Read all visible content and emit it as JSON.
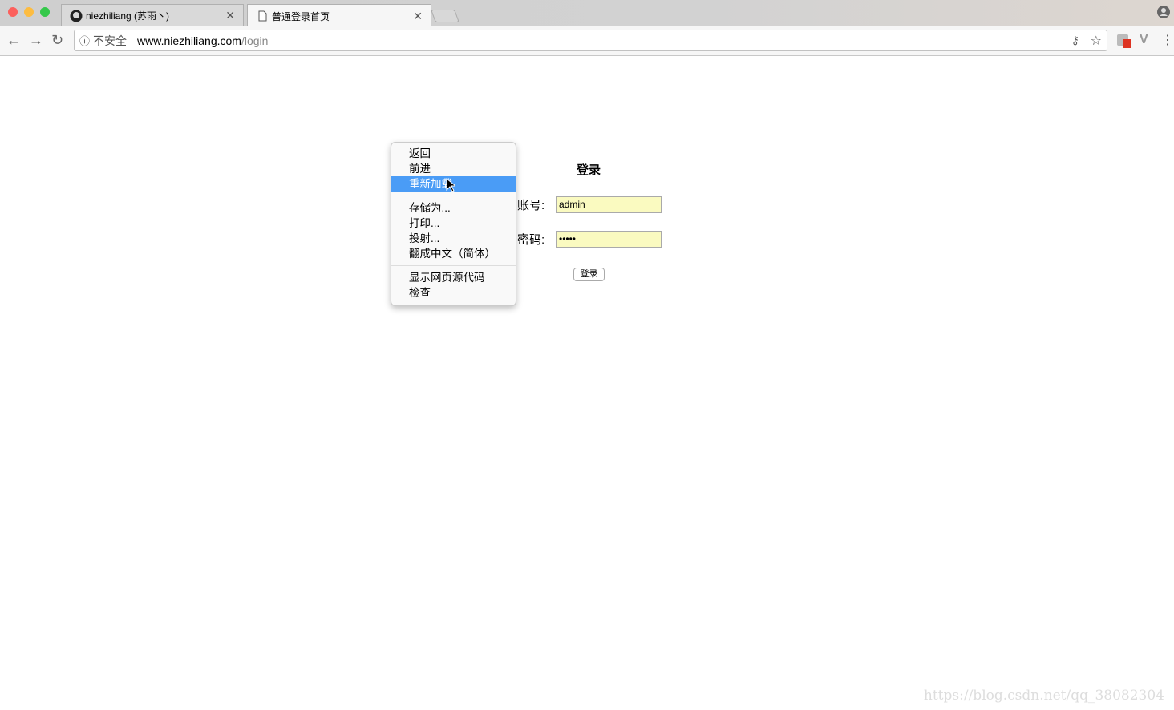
{
  "tabs": [
    {
      "title": "niezhiliang (苏雨丶)",
      "icon": "github-icon"
    },
    {
      "title": "普通登录首页",
      "icon": "page-icon"
    }
  ],
  "address": {
    "security": "不安全",
    "host": "www.niezhiliang.com",
    "path": "/login"
  },
  "extension_badge": "!",
  "context_menu": {
    "items": [
      "返回",
      "前进",
      "重新加载",
      "存储为...",
      "打印...",
      "投射...",
      "翻成中文（简体）",
      "显示网页源代码",
      "检查"
    ],
    "highlighted": "重新加载"
  },
  "form": {
    "title": "登录",
    "username_label": "账号:",
    "username_value": "admin",
    "password_label": "密码:",
    "password_value": "•••••",
    "submit": "登录"
  },
  "watermark": "https://blog.csdn.net/qq_38082304",
  "colors": {
    "highlight": "#4a9cf6",
    "autofill": "#fafac0"
  }
}
